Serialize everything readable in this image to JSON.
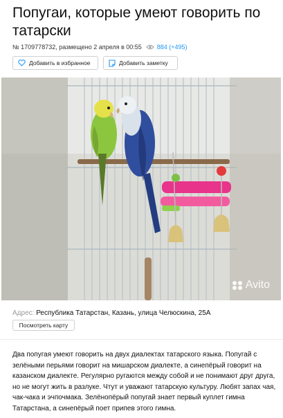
{
  "header": {
    "title": "Попугаи, которые умеют говорить по татарски",
    "ad_number": "№ 1709778732, размещено 2 апреля в 00:55",
    "views": "884 (+495)"
  },
  "actions": {
    "favorite_label": "Добавить в избранное",
    "note_label": "Добавить заметку"
  },
  "photo": {
    "watermark": "Avito",
    "colors": {
      "green_budgie": "#8cc63f",
      "blue_budgie": "#2f4e9e",
      "perch_pink": "#e8348a"
    }
  },
  "location": {
    "label": "Адрес:",
    "value": "Республика Татарстан, Казань, улица Челюскина, 25А",
    "map_button": "Посмотреть карту"
  },
  "description": "Два попугая умеют говорить на двух диалектах татарского языка. Попугай с зелёными перьями говорит на мишарском диалекте, а синепёрый говорит на казанском диалекте. Регулярно ругаются между собой и не понимают друг друга, но не могут жить в разлуке. Чтут и уважают татарскую культуру. Любят запах чая, чак-чака и эчпочмака. Зелёнопёрый попугай знает первый куплет гимна Татарстана, а синепёрый поет припев этого гимна."
}
